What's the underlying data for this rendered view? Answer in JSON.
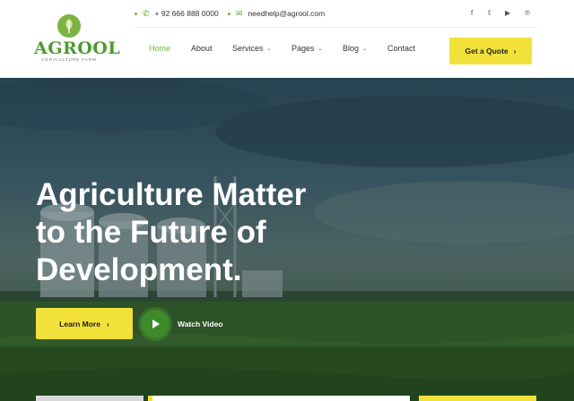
{
  "brand": {
    "name": "AGROOL",
    "tagline": "AGRICULTURE FARM"
  },
  "topbar": {
    "phone": "+ 92 666 888 0000",
    "email": "needhelp@agrool.com",
    "social": [
      "f",
      "t",
      "yt",
      "p"
    ]
  },
  "nav": {
    "items": [
      {
        "label": "Home",
        "active": true,
        "dropdown": false
      },
      {
        "label": "About",
        "active": false,
        "dropdown": false
      },
      {
        "label": "Services",
        "active": false,
        "dropdown": true
      },
      {
        "label": "Pages",
        "active": false,
        "dropdown": true
      },
      {
        "label": "Blog",
        "active": false,
        "dropdown": true
      },
      {
        "label": "Contact",
        "active": false,
        "dropdown": false
      }
    ],
    "cta_label": "Get a Quote"
  },
  "hero": {
    "headline_line1": "Agriculture Matter",
    "headline_line2": "to the Future of",
    "headline_line3": "Development.",
    "primary_button": "Learn More",
    "video_label": "Watch Video"
  },
  "colors": {
    "accent": "#f2e13a",
    "brand_green": "#6db33f",
    "play_green": "#3e8a2a"
  },
  "icons": [
    "logo-leaf-icon",
    "phone-icon",
    "mail-icon",
    "facebook-icon",
    "twitter-icon",
    "youtube-icon",
    "pinterest-icon",
    "chevron-down-icon",
    "chevron-right-icon",
    "play-icon"
  ]
}
